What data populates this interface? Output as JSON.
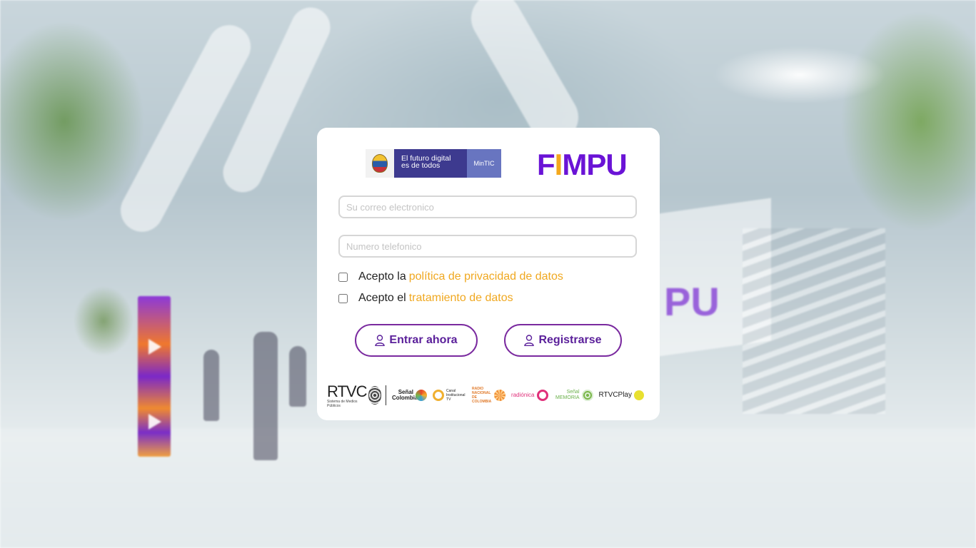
{
  "login": {
    "email_placeholder": "Su correo electronico",
    "phone_placeholder": "Numero telefonico",
    "privacy_prefix": "Acepto la",
    "privacy_link": "política de privacidad de datos",
    "data_prefix": "Acepto el",
    "data_link": "tratamiento de datos",
    "enter_label": "Entrar ahora",
    "register_label": "Registrarse"
  },
  "branding": {
    "mintic_slogan_line1": "El futuro digital",
    "mintic_slogan_line2": "es de todos",
    "mintic_tag": "MinTIC",
    "fimpu_f": "F",
    "fimpu_i": "I",
    "fimpu_rest": "MPU"
  },
  "partners": {
    "rtvc": "RTVC",
    "rtvc_sub": "Sistema de Medios Públicos",
    "senal_colombia": "Señal Colombia",
    "canal_institucional": "Canal Institucional TV",
    "radio_nacional": "RADIO NACIONAL DE COLOMBIA",
    "radionica": "radiónica",
    "senal_memoria": "Señal MEMORIA",
    "rtvc_play": "RTVCPlay"
  },
  "colors": {
    "accent_purple": "#6a13d6",
    "link_orange": "#f0a820",
    "button_border": "#7a2a9f"
  }
}
